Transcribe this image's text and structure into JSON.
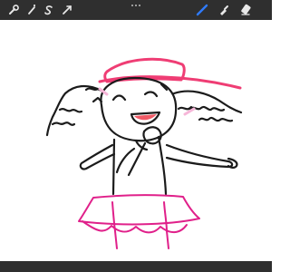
{
  "toolbar": {
    "left_tools": [
      {
        "name": "wrench-icon"
      },
      {
        "name": "magic-wand-icon"
      },
      {
        "name": "selection-s-icon"
      },
      {
        "name": "transform-arrow-icon"
      }
    ],
    "right_tools": [
      {
        "name": "brush-icon",
        "active": true,
        "color": "#2f7bff"
      },
      {
        "name": "smudge-icon"
      },
      {
        "name": "eraser-icon"
      }
    ]
  },
  "colors": {
    "toolbar_bg": "#2f2f2f",
    "accent_blue": "#2f7bff",
    "ink_black": "#1b1b1b",
    "skirt_pink": "#e0208a",
    "hat_pink": "#ef3d74"
  }
}
